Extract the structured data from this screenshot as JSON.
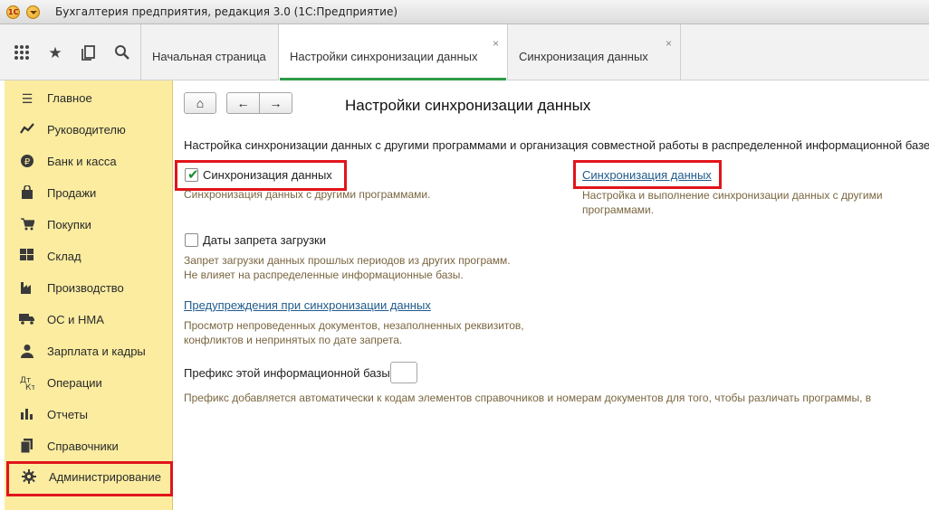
{
  "window": {
    "title": "Бухгалтерия предприятия, редакция 3.0  (1С:Предприятие)"
  },
  "toolbar": {
    "icons": [
      "grid-menu-icon",
      "star-icon",
      "history-icon",
      "search-icon"
    ]
  },
  "tabs": [
    {
      "label": "Начальная страница",
      "closable": false
    },
    {
      "label": "Настройки синхронизации данных",
      "closable": true,
      "active": true,
      "close_glyph": "×"
    },
    {
      "label": "Синхронизация данных",
      "closable": true,
      "close_glyph": "×"
    }
  ],
  "sidebar": {
    "items": [
      {
        "label": "Главное",
        "icon": "menu-lines-icon"
      },
      {
        "label": "Руководителю",
        "icon": "trend-icon"
      },
      {
        "label": "Банк и касса",
        "icon": "ruble-icon"
      },
      {
        "label": "Продажи",
        "icon": "shopping-bag-icon"
      },
      {
        "label": "Покупки",
        "icon": "cart-icon"
      },
      {
        "label": "Склад",
        "icon": "warehouse-icon"
      },
      {
        "label": "Производство",
        "icon": "factory-icon"
      },
      {
        "label": "ОС и НМА",
        "icon": "truck-icon"
      },
      {
        "label": "Зарплата и кадры",
        "icon": "person-icon"
      },
      {
        "label": "Операции",
        "icon": "operations-icon"
      },
      {
        "label": "Отчеты",
        "icon": "bar-chart-icon"
      },
      {
        "label": "Справочники",
        "icon": "books-icon"
      },
      {
        "label": "Администрирование",
        "icon": "gear-icon",
        "highlighted": true
      }
    ]
  },
  "main": {
    "nav": {
      "home": "⌂",
      "back": "←",
      "forward": "→"
    },
    "title": "Настройки синхронизации данных",
    "description": "Настройка синхронизации данных с другими программами и организация совместной работы в распределенной информационной базе.",
    "sync": {
      "checkbox_label": "Синхронизация данных",
      "checked": true,
      "note": "Синхронизация данных с другими программами.",
      "link": "Синхронизация данных",
      "link_note_1": "Настройка и выполнение синхронизации данных с другими",
      "link_note_2": "программами."
    },
    "ban_dates": {
      "checkbox_label": "Даты запрета загрузки",
      "checked": false,
      "note_1": "Запрет загрузки данных прошлых периодов из других программ.",
      "note_2": "Не влияет на распределенные информационные базы."
    },
    "warnings": {
      "link": "Предупреждения при синхронизации данных",
      "note_1": "Просмотр непроведенных документов, незаполненных реквизитов,",
      "note_2": "конфликтов и непринятых по дате запрета."
    },
    "prefix": {
      "label": "Префикс этой информационной базы:",
      "value": "",
      "note": "Префикс добавляется автоматически к кодам элементов справочников и номерам документов для того, чтобы различать программы, в"
    }
  },
  "colors": {
    "sidebar_bg": "#fbeca0",
    "highlight_red": "#e1141b",
    "active_tab_underline": "#2e9b47",
    "link": "#1f5a8c"
  }
}
